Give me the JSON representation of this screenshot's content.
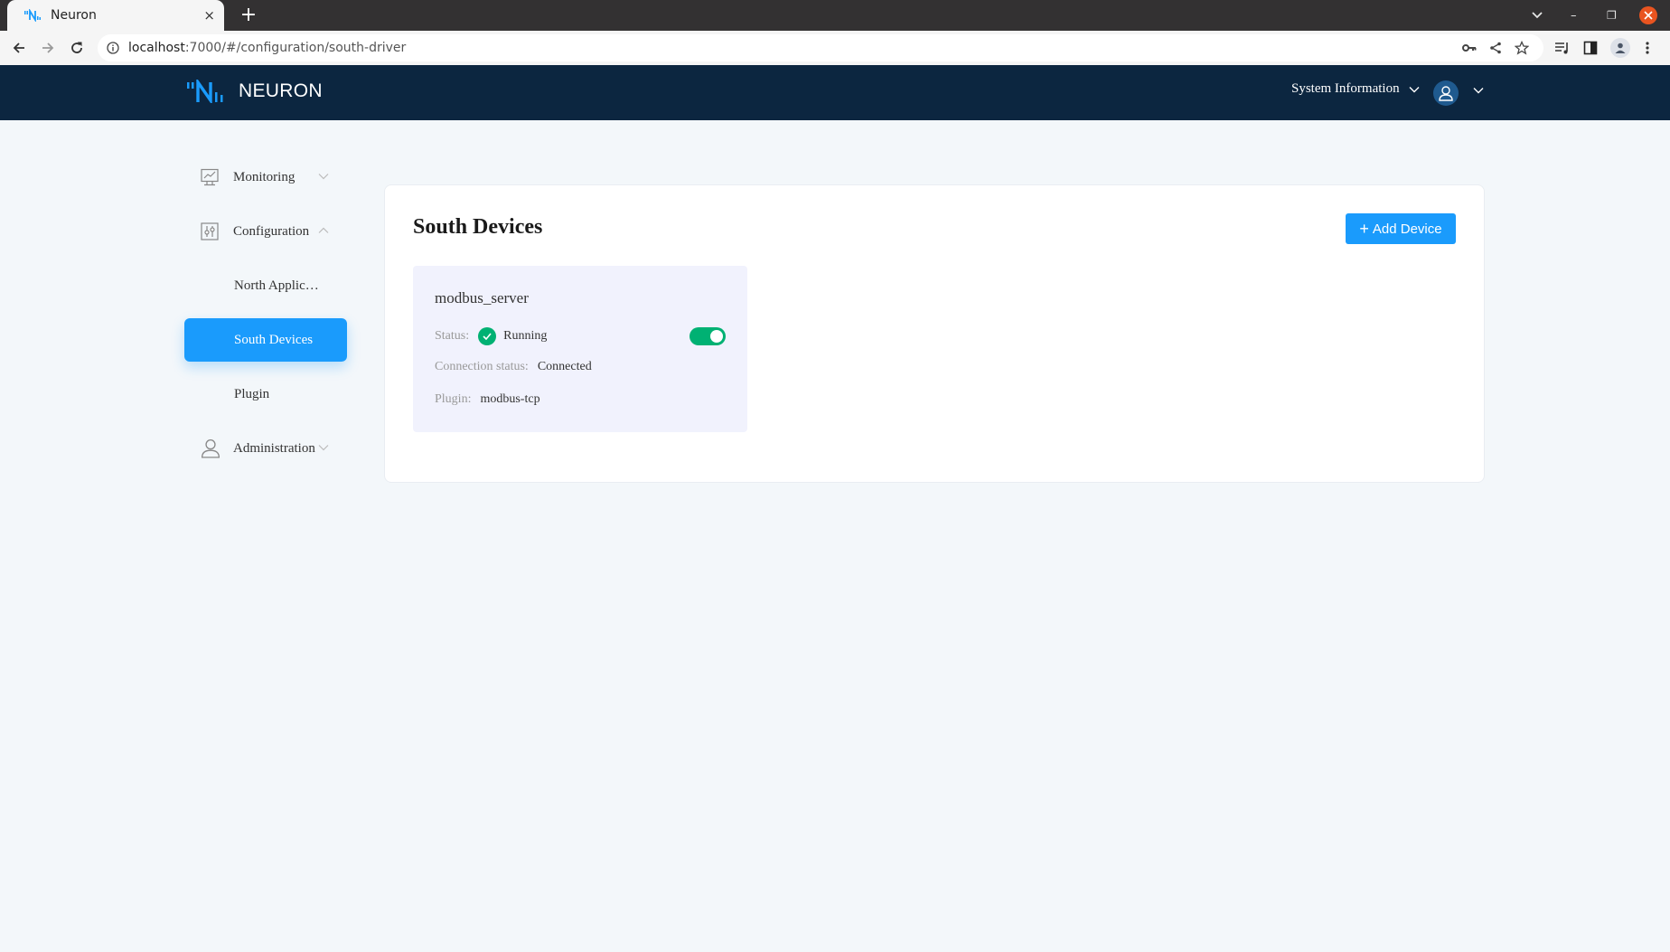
{
  "browser": {
    "tab_title": "Neuron",
    "tab_close": "×",
    "new_tab": "+",
    "url_host": "localhost",
    "url_rest": ":7000/#/configuration/south-driver",
    "window_controls": {
      "minimize": "–",
      "restore": "❐",
      "close": "✕"
    }
  },
  "header": {
    "brand": "NEURON",
    "system_info_label": "System Information"
  },
  "sidebar": {
    "items": [
      {
        "label": "Monitoring",
        "icon": "monitor-icon",
        "expanded": false
      },
      {
        "label": "Configuration",
        "icon": "sliders-icon",
        "expanded": true
      },
      {
        "label": "North Applic…",
        "sub": true
      },
      {
        "label": "South Devices",
        "sub": true,
        "active": true
      },
      {
        "label": "Plugin",
        "sub": true
      },
      {
        "label": "Administration",
        "icon": "user-icon",
        "expanded": false
      }
    ]
  },
  "main": {
    "title": "South Devices",
    "add_button_label": "Add Device",
    "devices": [
      {
        "name": "modbus_server",
        "status_label": "Status:",
        "status_value": "Running",
        "connection_label": "Connection status:",
        "connection_value": "Connected",
        "plugin_label": "Plugin:",
        "plugin_value": "modbus-tcp",
        "enabled": true
      }
    ]
  },
  "colors": {
    "accent": "#1a9bfc",
    "header_bg": "#0c2640",
    "running_green": "#00b173",
    "card_bg": "#f1f2fd"
  }
}
